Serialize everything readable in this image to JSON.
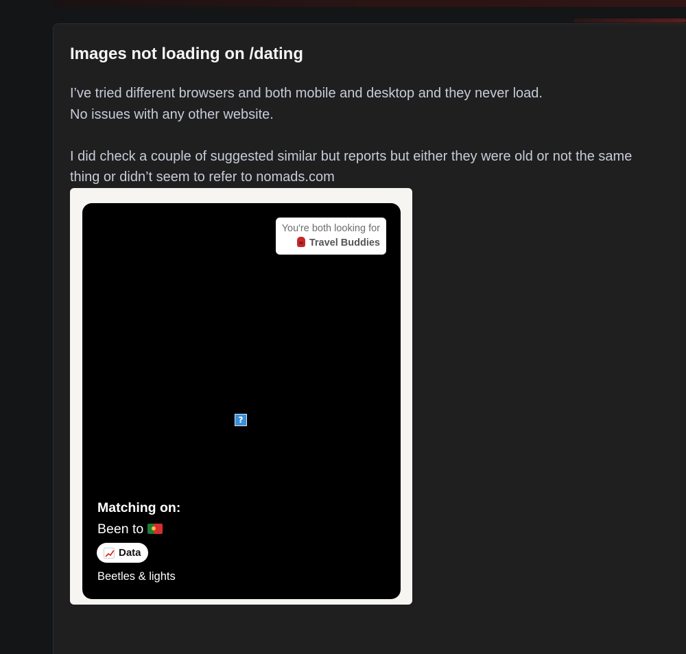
{
  "post": {
    "title": "Images not loading on /dating",
    "body_line_1": "I’ve tried different browsers and both mobile and desktop and they never load.",
    "body_line_2": "No issues with any other website.",
    "body_line_3": "I did check a couple of suggested similar but reports but either they were old or not  the same thing or didn’t seem to refer to nomads.com"
  },
  "screenshot": {
    "looking_label": "You're both looking for",
    "looking_value": "Travel Buddies",
    "looking_icon": "backpack-icon",
    "broken_image_icon": "broken-image-icon",
    "broken_image_glyph": "?",
    "matching_title": "Matching on:",
    "been_to_label": "Been to",
    "flag_icon": "portugal-flag-icon",
    "interest_chip": "Data",
    "interest_icon": "chart-increasing-icon",
    "caption": "Beetles & lights"
  },
  "colors": {
    "page_bg": "#141516",
    "card_bg": "#1f1f20",
    "title": "#f5f5f5",
    "body_text": "#c8ccd8",
    "profile_bg": "#000000",
    "frame_bg": "#f7f5f2"
  }
}
